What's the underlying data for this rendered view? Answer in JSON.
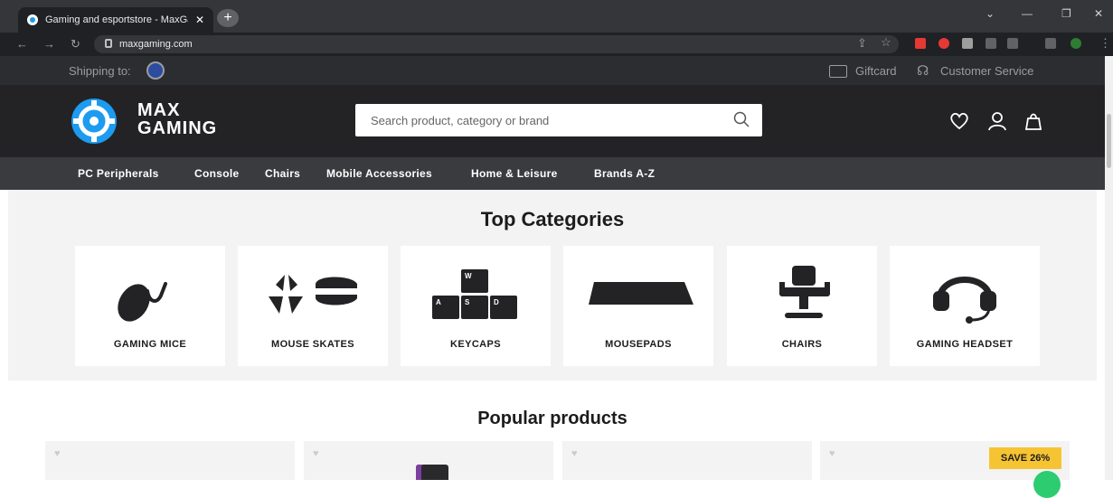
{
  "browser": {
    "tab_title": "Gaming and esportstore - MaxGa",
    "url": "maxgaming.com"
  },
  "topbar": {
    "shipping_label": "Shipping to:",
    "giftcard": "Giftcard",
    "customer_service": "Customer Service"
  },
  "header": {
    "logo_line1": "MAX",
    "logo_line2": "GAMING",
    "search_placeholder": "Search product, category or brand"
  },
  "nav": {
    "items": [
      "PC Peripherals",
      "Console",
      "Chairs",
      "Mobile Accessories",
      "Home & Leisure",
      "Brands A-Z"
    ]
  },
  "top_categories": {
    "title": "Top Categories",
    "items": [
      "GAMING MICE",
      "MOUSE SKATES",
      "KEYCAPS",
      "MOUSEPADS",
      "CHAIRS",
      "GAMING HEADSET"
    ]
  },
  "keycaps": {
    "w": "W",
    "a": "A",
    "s": "S",
    "d": "D"
  },
  "popular": {
    "title": "Popular products",
    "badge": "SAVE 26%"
  },
  "colors": {
    "accent": "#1d9bf0",
    "dark": "#232326",
    "badge": "#f6c433"
  }
}
